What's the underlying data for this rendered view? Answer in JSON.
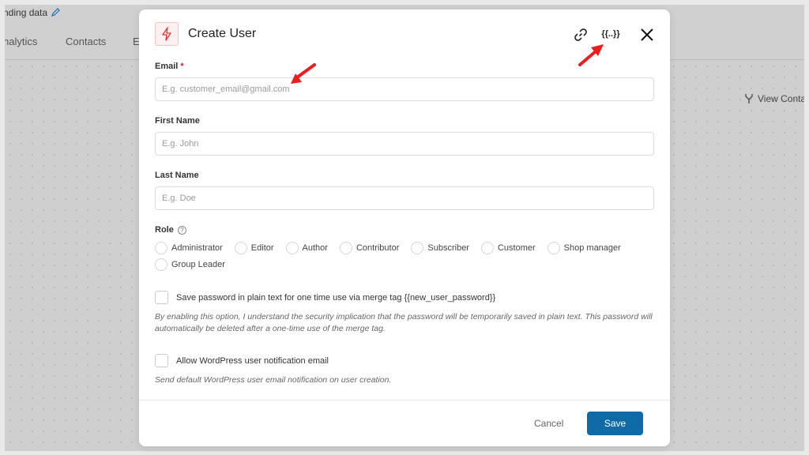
{
  "background": {
    "breadcrumb": "nding data",
    "tabs": [
      "nalytics",
      "Contacts",
      "E"
    ],
    "view_contacts": "View Contac"
  },
  "modal": {
    "title": "Create User",
    "icon": "lightning-icon",
    "merge_tag_label": "{{..}}",
    "fields": {
      "email": {
        "label": "Email",
        "required": "*",
        "placeholder": "E.g. customer_email@gmail.com",
        "value": ""
      },
      "first_name": {
        "label": "First Name",
        "placeholder": "E.g. John",
        "value": ""
      },
      "last_name": {
        "label": "Last Name",
        "placeholder": "E.g. Doe",
        "value": ""
      }
    },
    "role": {
      "label": "Role",
      "options": [
        "Administrator",
        "Editor",
        "Author",
        "Contributor",
        "Subscriber",
        "Customer",
        "Shop manager",
        "Group Leader"
      ]
    },
    "save_password": {
      "label": "Save password in plain text for one time use via merge tag {{new_user_password}}",
      "checked": false,
      "description": "By enabling this option, I understand the security implication that the password will be temporarily saved in plain text. This password will automatically be deleted after a one-time use of the merge tag."
    },
    "notify": {
      "label": "Allow WordPress user notification email",
      "checked": false,
      "description": "Send default WordPress user email notification on user creation."
    },
    "cancel_label": "Cancel",
    "save_label": "Save"
  },
  "colors": {
    "primary": "#0f6aa6",
    "required": "#e02020",
    "annotation_arrow": "#ee1c1c"
  }
}
